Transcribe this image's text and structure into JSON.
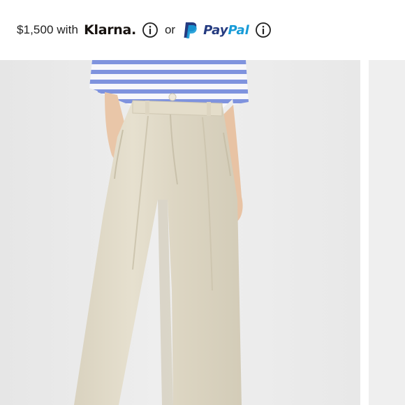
{
  "payment": {
    "amount_text": "$1,500 with",
    "klarna_label": "Klarna.",
    "or_text": "or",
    "paypal_pay": "Pay",
    "paypal_pal": "Pal"
  },
  "icons": {
    "klarna_info": "info-icon",
    "paypal_info": "info-icon",
    "paypal_logo": "paypal-logo"
  },
  "colors": {
    "paypal_dark": "#253b80",
    "paypal_light": "#179bd7",
    "photo_background": "#ededed",
    "pants": "#e2dccb",
    "stripe_blue": "#7f93de"
  },
  "gallery": {
    "main_image": "model wearing beige wide-leg pleated trousers with a blue and white striped top",
    "next_image": "next product photo (partially visible)"
  }
}
